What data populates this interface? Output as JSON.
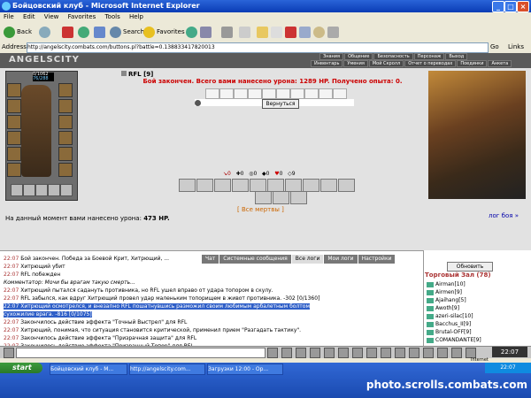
{
  "window": {
    "title": "Бойцовский клуб - Microsoft Internet Explorer",
    "controls": [
      "_",
      "□",
      "×"
    ]
  },
  "menu": [
    "File",
    "Edit",
    "View",
    "Favorites",
    "Tools",
    "Help"
  ],
  "toolbar": {
    "back": "Back",
    "search": "Search",
    "favorites": "Favorites"
  },
  "address": {
    "label": "Address",
    "url": "http://angelscity.combats.com/buttons.pl?battle=0.138833417820013",
    "go": "Go",
    "links": "Links"
  },
  "site": {
    "logo": "ANGELSCITY",
    "nav_top": [
      "Знания",
      "Общение",
      "Безопасность",
      "Персонаж",
      "Выход"
    ],
    "nav_bottom": [
      "Инвентарь",
      "Умения",
      "Мой Скролл",
      "Отчет о переводах",
      "Поединки",
      "Анкета"
    ]
  },
  "character": {
    "hp": "0/1062",
    "mp": "76/288"
  },
  "battle": {
    "player": "RFL [9]",
    "message": "Бой закончен. Всего вами нанесено урона: 1289 HP. Получено опыта: 0.",
    "back_button": "Вернуться",
    "stats": [
      "0",
      "0",
      "0",
      "0",
      "0",
      "9"
    ],
    "all_dead": "[ Все мертвы ]",
    "damage_label": "На данный момент вами нанесено урона:",
    "damage_value": "473 HP.",
    "fight_log": "лог боя »"
  },
  "chat": {
    "tabs": [
      "Чат",
      "Системные сообщения",
      "Все логи",
      "Мои логи",
      "Настройки"
    ],
    "lines": [
      {
        "t": "22:07",
        "text": "Бой закончен. Победа за Боевой Крит, Хитрющий, ..."
      },
      {
        "t": "22:07",
        "text": "Хитрющий убит"
      },
      {
        "t": "22:07",
        "text": "RFL побежден"
      },
      {
        "t": "",
        "text": "Комментатор: Мочи бы врагам такую смерть..."
      },
      {
        "t": "22:07",
        "text": "Хитрющий пытался садануть противника, но RFL ушел вправо от удара топором в скулу."
      },
      {
        "t": "22:07",
        "text": "RFL забылся, как вдруг Хитрющий провел удар маленьким топорищем в живот противника. -302 [0/1360]"
      },
      {
        "t": "22:07",
        "text": "Хитрющий осмотрелся, и внезапно RFL пошатнувшись разможил своим любимым арбалетным болтом"
      },
      {
        "t": "",
        "text": "сухожилие врага. -816 [0/1075]"
      },
      {
        "t": "22:07",
        "text": "Закончилось действие эффекта \"Точный Выстрел\" для RFL"
      },
      {
        "t": "22:07",
        "text": "Хитрющий, понимая, что ситуация становится критической, применил прием \"Разгадать тактику\"."
      },
      {
        "t": "22:07",
        "text": "Закончилось действие эффекта \"Призрачная защита\" для RFL"
      },
      {
        "t": "22:07",
        "text": "Закончилось действие эффекта \"Призрачный Топор\" для RFL"
      }
    ]
  },
  "roster": {
    "refresh": "Обновить",
    "hall": "Торговый Зал (78)",
    "users": [
      "Airman[10]",
      "Airmen[9]",
      "Ajaihang[5]",
      "Awoth[9]",
      "azeri-silac[10]",
      "Bacchus_II[9]",
      "Brutal-OFF[9]",
      "COMANDANTE[9]"
    ]
  },
  "statusbar": {
    "zone": "Internet"
  },
  "taskbar": {
    "start": "start",
    "tasks": [
      "Бойцовский клуб - M...",
      "http://angelscity.com...",
      "Загрузки 12:00 - Op..."
    ],
    "clock": "22:07"
  },
  "watermark": "photo.scrolls.combats.com",
  "colors": {
    "title": "#0a3cb5",
    "battle_red": "#cc0000",
    "chat_time": "#aa3333",
    "highlight": "#2f5fc8"
  }
}
